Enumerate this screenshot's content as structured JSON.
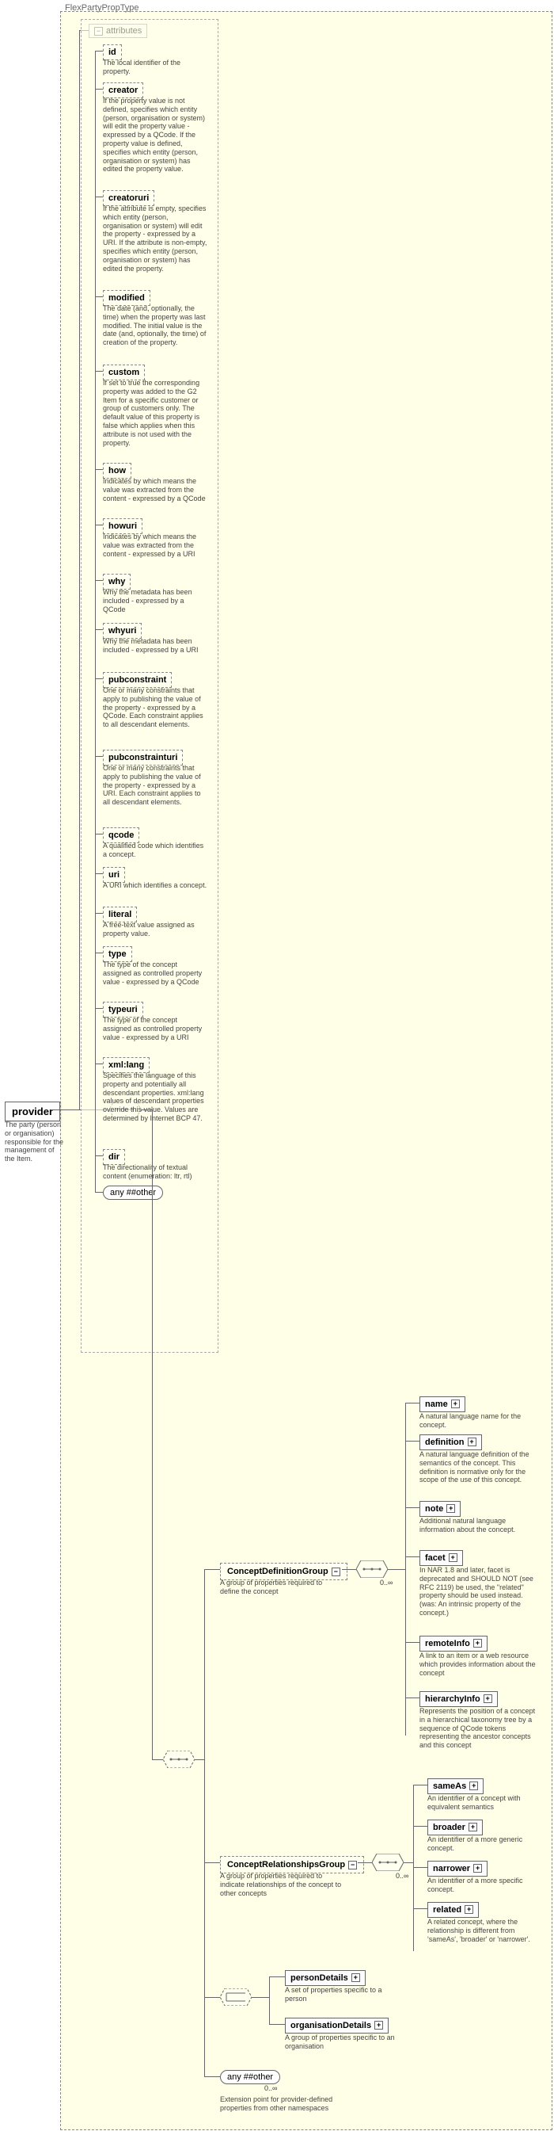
{
  "type_label": "FlexPartyPropType",
  "root": {
    "name": "provider",
    "desc": "The party (person or organisation) responsible for the management of the Item."
  },
  "attributes_header": "attributes",
  "attributes": [
    {
      "name": "id",
      "desc": "The local identifier of the property."
    },
    {
      "name": "creator",
      "desc": "If the property value is not defined, specifies which entity (person, organisation or system) will edit the property value - expressed by a QCode. If the property value is defined, specifies which entity (person, organisation or system) has edited the property value."
    },
    {
      "name": "creatoruri",
      "desc": "If the attribute is empty, specifies which entity (person, organisation or system) will edit the property - expressed by a URI. If the attribute is non-empty, specifies which entity (person, organisation or system) has edited the property."
    },
    {
      "name": "modified",
      "desc": "The date (and, optionally, the time) when the property was last modified. The initial value is the date (and, optionally, the time) of creation of the property."
    },
    {
      "name": "custom",
      "desc": "If set to true the corresponding property was added to the G2 Item for a specific customer or group of customers only. The default value of this property is false which applies when this attribute is not used with the property."
    },
    {
      "name": "how",
      "desc": "Indicates by which means the value was extracted from the content - expressed by a QCode"
    },
    {
      "name": "howuri",
      "desc": "Indicates by which means the value was extracted from the content - expressed by a URI"
    },
    {
      "name": "why",
      "desc": "Why the metadata has been included - expressed by a QCode"
    },
    {
      "name": "whyuri",
      "desc": "Why the metadata has been included - expressed by a URI"
    },
    {
      "name": "pubconstraint",
      "desc": "One or many constraints that apply to publishing the value of the property - expressed by a QCode. Each constraint applies to all descendant elements."
    },
    {
      "name": "pubconstrainturi",
      "desc": "One or many constraints that apply to publishing the value of the property - expressed by a URI. Each constraint applies to all descendant elements."
    },
    {
      "name": "qcode",
      "desc": "A qualified code which identifies a concept."
    },
    {
      "name": "uri",
      "desc": "A URI which identifies a concept."
    },
    {
      "name": "literal",
      "desc": "A free-text value assigned as property value."
    },
    {
      "name": "type",
      "desc": "The type of the concept assigned as controlled property value - expressed by a QCode"
    },
    {
      "name": "typeuri",
      "desc": "The type of the concept assigned as controlled property value - expressed by a URI"
    },
    {
      "name": "xml:lang",
      "desc": "Specifies the language of this property and potentially all descendant properties. xml:lang values of descendant properties override this value. Values are determined by Internet BCP 47."
    },
    {
      "name": "dir",
      "desc": "The directionality of textual content (enumeration: ltr, rtl)"
    }
  ],
  "any_attr": "any ##other",
  "groups": {
    "definition": {
      "name": "ConceptDefinitionGroup",
      "desc": "A group of properties required to define the concept",
      "children": [
        {
          "name": "name",
          "desc": "A natural language name for the concept."
        },
        {
          "name": "definition",
          "desc": "A natural language definition of the semantics of the concept. This definition is normative only for the scope of the use of this concept."
        },
        {
          "name": "note",
          "desc": "Additional natural language information about the concept."
        },
        {
          "name": "facet",
          "desc": "In NAR 1.8 and later, facet is deprecated and SHOULD NOT (see RFC 2119) be used, the \"related\" property should be used instead. (was: An intrinsic property of the concept.)"
        },
        {
          "name": "remoteInfo",
          "desc": "A link to an item or a web resource which provides information about the concept"
        },
        {
          "name": "hierarchyInfo",
          "desc": "Represents the position of a concept in a hierarchical taxonomy tree by a sequence of QCode tokens representing the ancestor concepts and this concept"
        }
      ]
    },
    "relationships": {
      "name": "ConceptRelationshipsGroup",
      "desc": "A group of properties required to indicate relationships of the concept to other concepts",
      "children": [
        {
          "name": "sameAs",
          "desc": "An identifier of a concept with equivalent semantics"
        },
        {
          "name": "broader",
          "desc": "An identifier of a more generic concept."
        },
        {
          "name": "narrower",
          "desc": "An identifier of a more specific concept."
        },
        {
          "name": "related",
          "desc": "A related concept, where the relationship is different from 'sameAs', 'broader' or 'narrower'."
        }
      ]
    }
  },
  "choice_items": [
    {
      "name": "personDetails",
      "desc": "A set of properties specific to a person"
    },
    {
      "name": "organisationDetails",
      "desc": "A group of properties specific to an organisation"
    }
  ],
  "any_elem": {
    "label": "any ##other",
    "desc": "Extension point for provider-defined properties from other namespaces"
  },
  "occurrence": "0..∞"
}
